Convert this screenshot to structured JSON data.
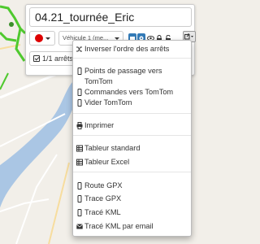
{
  "route": {
    "title": "04.21_tournée_Eric",
    "vehicle": "Véhicule 1 (me...",
    "stops_label": "1/1 arrêts"
  },
  "colors": {
    "route_color": "#dd0000",
    "map_route": "#5fd13a",
    "river": "#a8c3e0",
    "accent": "#337ab7"
  },
  "icons": {
    "color_picker": "circle",
    "tools": [
      "map-marker-icon",
      "gear-icon",
      "eye-icon",
      "lock-icon",
      "unlock-icon"
    ],
    "export": "export-icon"
  },
  "menu": {
    "reverse": "Inverser l'ordre des arrêts",
    "waypoints_line1": "Points de passage vers",
    "waypoints_line2": "TomTom",
    "orders_tomtom": "Commandes vers TomTom",
    "empty_tomtom": "Vider TomTom",
    "print": "Imprimer",
    "table_standard": "Tableur standard",
    "table_excel": "Tableur Excel",
    "route_gpx": "Route GPX",
    "trace_gpx": "Trace GPX",
    "trace_kml": "Tracé KML",
    "trace_kml_email": "Tracé KML par email"
  }
}
